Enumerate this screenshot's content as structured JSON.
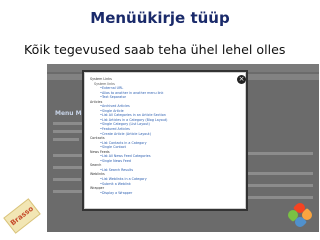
{
  "slide": {
    "title": "Menüükirje tüüp",
    "subtitle": "Kõik tegevused saab teha ühel lehel olles"
  },
  "background_admin": {
    "side_label": "Menu Mo"
  },
  "modal": {
    "close_symbol": "×",
    "tree": [
      {
        "kind": "cat",
        "text": "System Links"
      },
      {
        "kind": "sub",
        "text": "System links"
      },
      {
        "kind": "item",
        "text": "External URL"
      },
      {
        "kind": "item",
        "text": "Alias to another in another menu link"
      },
      {
        "kind": "item",
        "text": "Text Separator"
      },
      {
        "kind": "cat",
        "text": "Articles"
      },
      {
        "kind": "item",
        "text": "Archived Articles"
      },
      {
        "kind": "item",
        "text": "Single Article"
      },
      {
        "kind": "item",
        "text": "List All Categories in an Article Section"
      },
      {
        "kind": "item",
        "text": "List Articles in a Category (Blog Layout)"
      },
      {
        "kind": "item",
        "text": "Single Category (List Layout)"
      },
      {
        "kind": "item",
        "text": "Featured Articles"
      },
      {
        "kind": "item",
        "text": "Create Article (Article Layout)"
      },
      {
        "kind": "cat",
        "text": "Contacts"
      },
      {
        "kind": "item",
        "text": "List Contacts in a Category"
      },
      {
        "kind": "item",
        "text": "Single Contact"
      },
      {
        "kind": "cat",
        "text": "News Feeds"
      },
      {
        "kind": "item",
        "text": "List All News Feed Categories"
      },
      {
        "kind": "item",
        "text": "Single News Feed"
      },
      {
        "kind": "cat",
        "text": "Search"
      },
      {
        "kind": "item",
        "text": "List Search Results"
      },
      {
        "kind": "cat",
        "text": "Weblinks"
      },
      {
        "kind": "item",
        "text": "List Weblinks in a Category"
      },
      {
        "kind": "item",
        "text": "Submit a Weblink"
      },
      {
        "kind": "cat",
        "text": "Wrapper"
      },
      {
        "kind": "item",
        "text": "Display a Wrapper"
      }
    ]
  },
  "stamp_text": "Brasso",
  "colors": {
    "title": "#1a2a6a",
    "modal_link": "#2a5db0",
    "overlay": "#6b6b6b"
  }
}
